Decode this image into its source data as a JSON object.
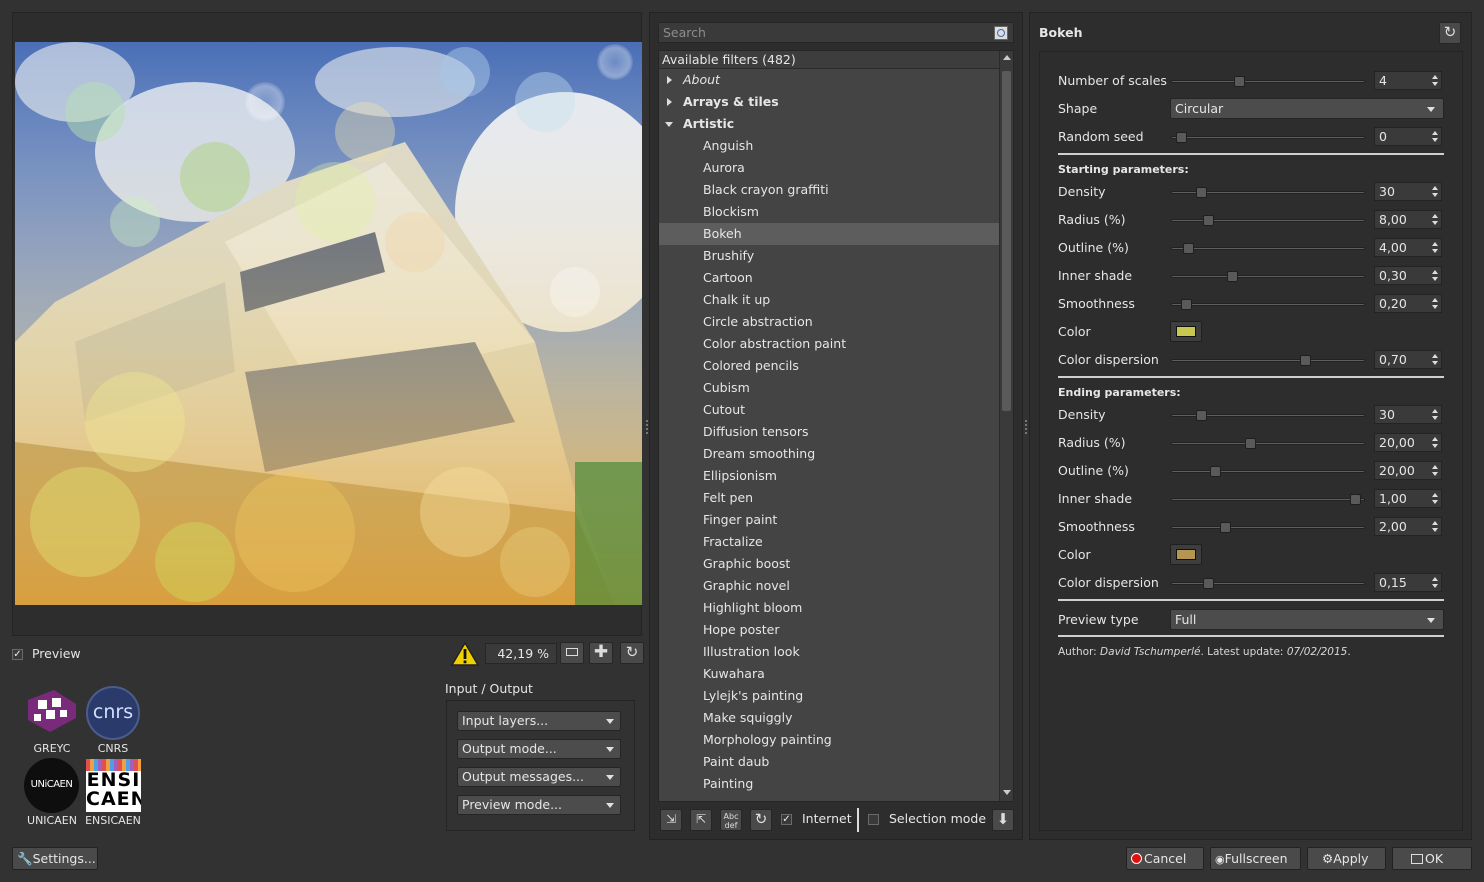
{
  "preview": {
    "checkbox_label": "Preview",
    "zoom": "42,19 %"
  },
  "logos": [
    {
      "label": "GREYC"
    },
    {
      "label": "CNRS",
      "glyph": "cnrs"
    },
    {
      "label": "UNICAEN",
      "glyph": "UNiCAEN"
    },
    {
      "label": "ENSICAEN",
      "glyph_top": "ENSI",
      "glyph_bottom": "CAEN"
    }
  ],
  "io": {
    "title": "Input / Output",
    "combos": [
      "Input layers...",
      "Output mode...",
      "Output messages...",
      "Preview mode..."
    ]
  },
  "settings_label": "Settings...",
  "filters": {
    "search_placeholder": "Search",
    "header": "Available filters (482)",
    "categories": [
      {
        "label": "About",
        "style": "italic",
        "expanded": false
      },
      {
        "label": "Arrays & tiles",
        "style": "bold",
        "expanded": false
      },
      {
        "label": "Artistic",
        "style": "bold",
        "expanded": true
      }
    ],
    "items": [
      "Anguish",
      "Aurora",
      "Black crayon graffiti",
      "Blockism",
      "Bokeh",
      "Brushify",
      "Cartoon",
      "Chalk it up",
      "Circle abstraction",
      "Color abstraction paint",
      "Colored pencils",
      "Cubism",
      "Cutout",
      "Diffusion tensors",
      "Dream smoothing",
      "Ellipsionism",
      "Felt pen",
      "Finger paint",
      "Fractalize",
      "Graphic boost",
      "Graphic novel",
      "Highlight bloom",
      "Hope poster",
      "Illustration look",
      "Kuwahara",
      "Lylejk's painting",
      "Make squiggly",
      "Morphology painting",
      "Paint daub",
      "Painting"
    ],
    "selected": "Bokeh",
    "toolbar": {
      "internet_label": "Internet",
      "selection_mode_label": "Selection mode"
    }
  },
  "params": {
    "title": "Bokeh",
    "top": [
      {
        "label": "Number of scales",
        "value": "4",
        "pos": 0.34
      },
      {
        "label": "Shape",
        "combo": "Circular"
      },
      {
        "label": "Random seed",
        "value": "0",
        "pos": 0.02
      }
    ],
    "starting_title": "Starting parameters:",
    "starting": [
      {
        "label": "Density",
        "value": "30",
        "pos": 0.13
      },
      {
        "label": "Radius (%)",
        "value": "8,00",
        "pos": 0.17
      },
      {
        "label": "Outline (%)",
        "value": "4,00",
        "pos": 0.06
      },
      {
        "label": "Inner shade",
        "value": "0,30",
        "pos": 0.3
      },
      {
        "label": "Smoothness",
        "value": "0,20",
        "pos": 0.05
      },
      {
        "label": "Color",
        "color": "#c8c850"
      },
      {
        "label": "Color dispersion",
        "value": "0,70",
        "pos": 0.7
      }
    ],
    "ending_title": "Ending parameters:",
    "ending": [
      {
        "label": "Density",
        "value": "30",
        "pos": 0.13
      },
      {
        "label": "Radius (%)",
        "value": "20,00",
        "pos": 0.4
      },
      {
        "label": "Outline (%)",
        "value": "20,00",
        "pos": 0.21
      },
      {
        "label": "Inner shade",
        "value": "1,00",
        "pos": 0.97
      },
      {
        "label": "Smoothness",
        "value": "2,00",
        "pos": 0.26
      },
      {
        "label": "Color",
        "color": "#b49650"
      },
      {
        "label": "Color dispersion",
        "value": "0,15",
        "pos": 0.17
      }
    ],
    "preview_type_label": "Preview type",
    "preview_type": "Full",
    "author_prefix": "Author: ",
    "author": "David Tschumperlé",
    "update_prefix": ". Latest update: ",
    "update_date": "07/02/2015",
    "update_suffix": "."
  },
  "buttons": {
    "cancel": "Cancel",
    "fullscreen": "Fullscreen",
    "apply": "Apply",
    "ok": "OK"
  }
}
